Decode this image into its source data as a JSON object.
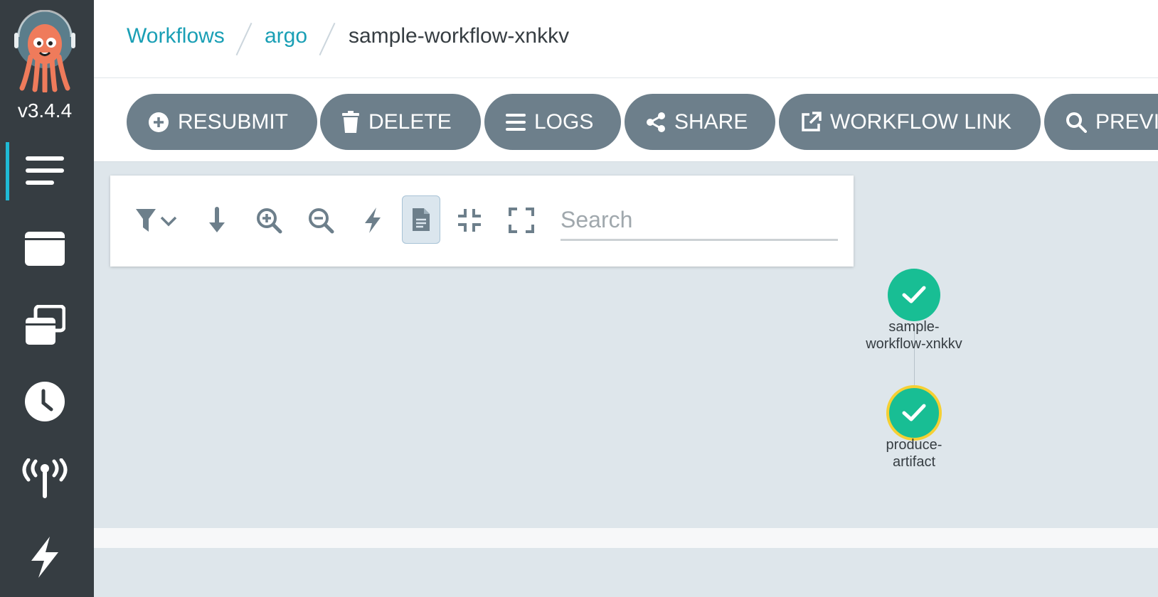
{
  "app": {
    "version": "v3.4.4"
  },
  "sidebar": {
    "items": [
      {
        "icon": "menu-lines-icon",
        "active": true
      },
      {
        "icon": "window-icon",
        "active": false
      },
      {
        "icon": "stacked-windows-icon",
        "active": false
      },
      {
        "icon": "clock-icon",
        "active": false
      },
      {
        "icon": "broadcast-icon",
        "active": false
      },
      {
        "icon": "lightning-icon",
        "active": false
      }
    ]
  },
  "breadcrumb": {
    "root": "Workflows",
    "namespace": "argo",
    "current": "sample-workflow-xnkkv"
  },
  "toolbar": {
    "resubmit": "RESUBMIT",
    "delete": "DELETE",
    "logs": "LOGS",
    "share": "SHARE",
    "workflow_link": "WORKFLOW LINK",
    "previous": "PREVI"
  },
  "graph": {
    "search_placeholder": "Search",
    "nodes": [
      {
        "label_line1": "sample-",
        "label_line2": "workflow-xnkkv",
        "status": "succeeded"
      },
      {
        "label_line1": "produce-",
        "label_line2": "artifact",
        "status": "succeeded",
        "selected": true
      }
    ]
  },
  "colors": {
    "accent": "#1fbad6",
    "link": "#1a9fb5",
    "button_bg": "#6d7f8b",
    "success": "#18be94",
    "selected_ring": "#f5d033",
    "sidebar_bg": "#363d42"
  }
}
